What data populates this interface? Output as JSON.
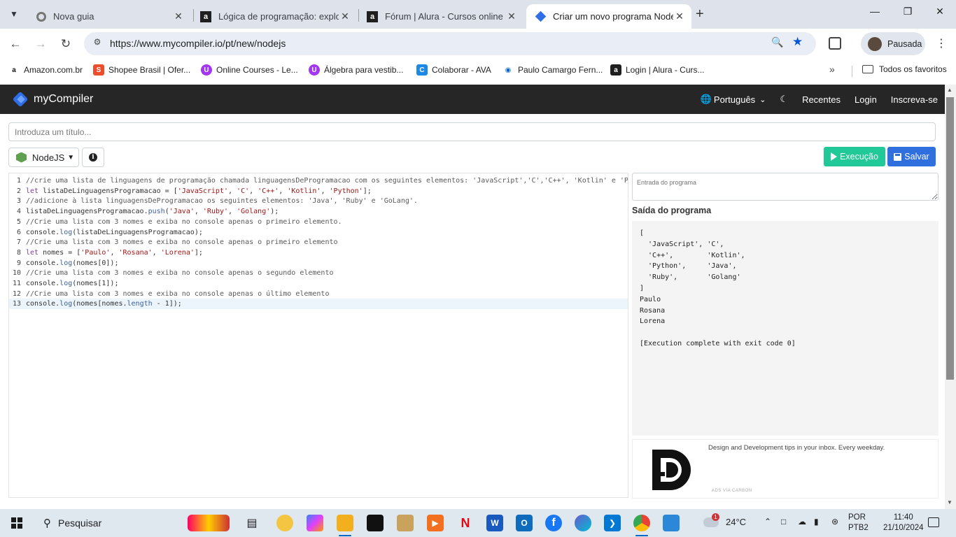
{
  "browser": {
    "tabs": [
      {
        "title": "Nova guia",
        "icon": "chrome-icon"
      },
      {
        "title": "Lógica de programação: explore",
        "icon": "alura-icon"
      },
      {
        "title": "Fórum | Alura - Cursos online de",
        "icon": "alura-icon"
      },
      {
        "title": "Criar um novo programa NodeJ",
        "icon": "mycompiler-icon"
      }
    ],
    "url": "https://www.mycompiler.io/pt/new/nodejs",
    "profile": "Pausada",
    "bookmarks": [
      "Amazon.com.br",
      "Shopee Brasil | Ofer...",
      "Online Courses - Le...",
      "Álgebra para vestib...",
      "Colaborar - AVA",
      "Paulo Camargo Fern...",
      "Login | Alura - Curs..."
    ],
    "all_bookmarks": "Todos os favoritos"
  },
  "site": {
    "brand": "myCompiler",
    "language": "Português",
    "recent": "Recentes",
    "login": "Login",
    "signup": "Inscreva-se",
    "title_placeholder": "Introduza um título...",
    "lang_select": "NodeJS",
    "run": "Execução",
    "save": "Salvar",
    "input_placeholder": "Entrada do programa",
    "output_title": "Saída do programa",
    "output_lines": [
      "[",
      "  'JavaScript', 'C',",
      "  'C++',        'Kotlin',",
      "  'Python',     'Java',",
      "  'Ruby',       'Golang'",
      "]",
      "Paulo",
      "Rosana",
      "Lorena",
      "",
      "[Execution complete with exit code 0]"
    ],
    "ad_text": "Design and Development tips in your inbox. Every weekday.",
    "ad_via": "ADS VIA CARBON"
  },
  "code": [
    "//crie uma lista de linguagens de programação chamada linguagensDeProgramacao com os seguintes elementos: 'JavaScript','C','C++', 'Kotlin' e 'Python",
    "let listaDeLinguagensProgramacao = ['JavaScript', 'C', 'C++', 'Kotlin', 'Python'];",
    "//adicione à lista linguagensDeProgramacao os seguintes elementos: 'Java', 'Ruby' e 'GoLang'.",
    "listaDeLinguagensProgramacao.push('Java', 'Ruby', 'Golang');",
    "//Crie uma lista com 3 nomes e exiba no console apenas o primeiro elemento.",
    "console.log(listaDeLinguagensProgramacao);",
    "//Crie uma lista com 3 nomes e exiba no console apenas o primeiro elemento",
    "let nomes = ['Paulo', 'Rosana', 'Lorena'];",
    "console.log(nomes[0]);",
    "//Crie uma lista com 3 nomes e exiba no console apenas o segundo elemento",
    "console.log(nomes[1]);",
    "//Crie uma lista com 3 nomes e exiba no console apenas o último elemento",
    "console.log(nomes[nomes.length - 1]);"
  ],
  "active_line": 13,
  "taskbar": {
    "search": "Pesquisar",
    "weather": "24°C",
    "lang1": "POR",
    "lang2": "PTB2",
    "time": "11:40",
    "date": "21/10/2024",
    "weather_badge": "1"
  },
  "colors": {
    "run": "#20c997",
    "save": "#2f6fde",
    "nav": "#262626"
  }
}
